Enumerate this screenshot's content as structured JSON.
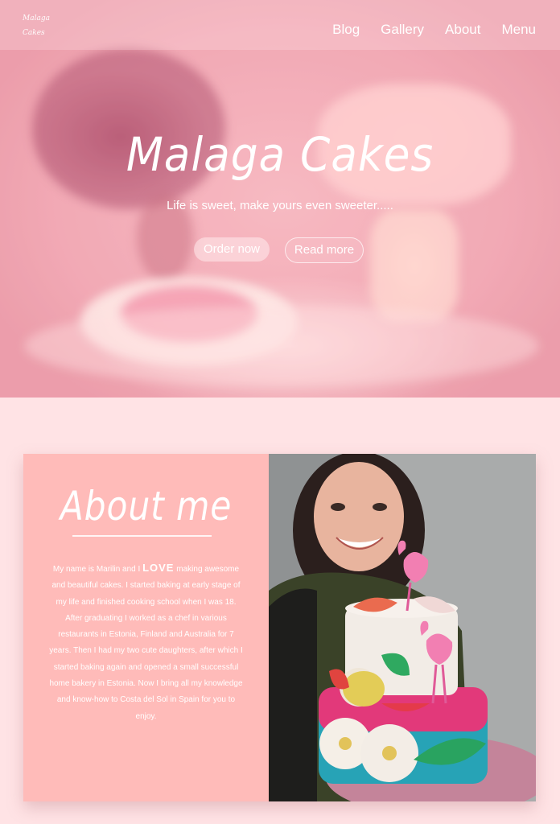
{
  "nav": {
    "logo_line1": "Malaga",
    "logo_line2": "Cakes",
    "items": [
      "Blog",
      "Gallery",
      "About",
      "Menu"
    ]
  },
  "hero": {
    "title": "Malaga Cakes",
    "tagline": "Life is sweet, make yours even sweeter.....",
    "order_label": "Order now",
    "read_label": "Read more"
  },
  "about": {
    "title": "About me",
    "body_before": "My name is Marilin and I ",
    "body_love": "LOVE",
    "body_after": " making awesome and beautiful cakes. I started baking at early stage of my life and finished cooking school when I was 18.  After graduating I worked as a chef in various restaurants in Estonia, Finland and Australia for 7 years.  Then I had my two cute daughters, after which I started baking again and opened a small successful home bakery in Estonia. Now I bring all my knowledge and know-how to Costa del Sol in Spain for you to enjoy."
  },
  "colors": {
    "page_bg": "#ffe3e5",
    "about_panel": "#ffbbb9",
    "hero_tint": "#f6b3bc"
  }
}
